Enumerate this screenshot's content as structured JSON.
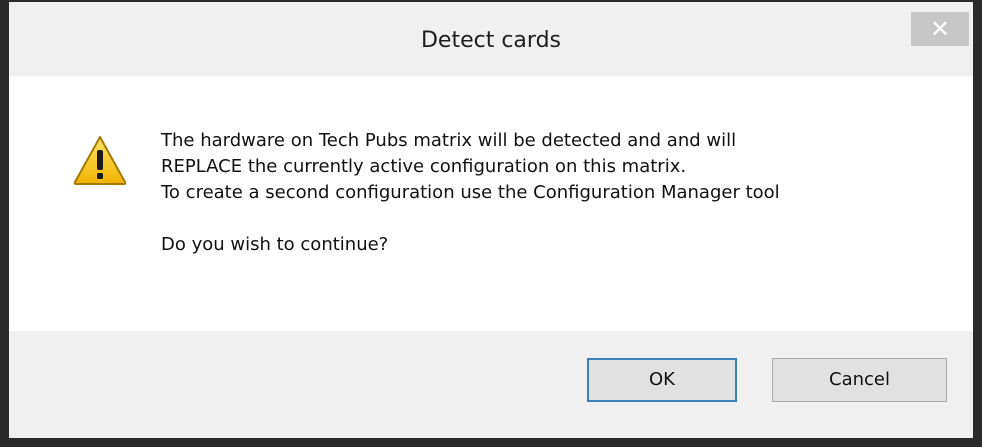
{
  "window": {
    "title": "Detect cards",
    "close_glyph": "✕"
  },
  "message": {
    "line1": "The hardware on Tech Pubs matrix will be detected and and will",
    "line2": "REPLACE the currently active configuration on this matrix.",
    "line3": "To create a second configuration use the Configuration Manager tool",
    "question": "Do you wish to continue?"
  },
  "icon": {
    "name": "warning-icon",
    "fill": "#f4c20d",
    "mark": "!"
  },
  "buttons": {
    "ok_label": "OK",
    "cancel_label": "Cancel"
  }
}
